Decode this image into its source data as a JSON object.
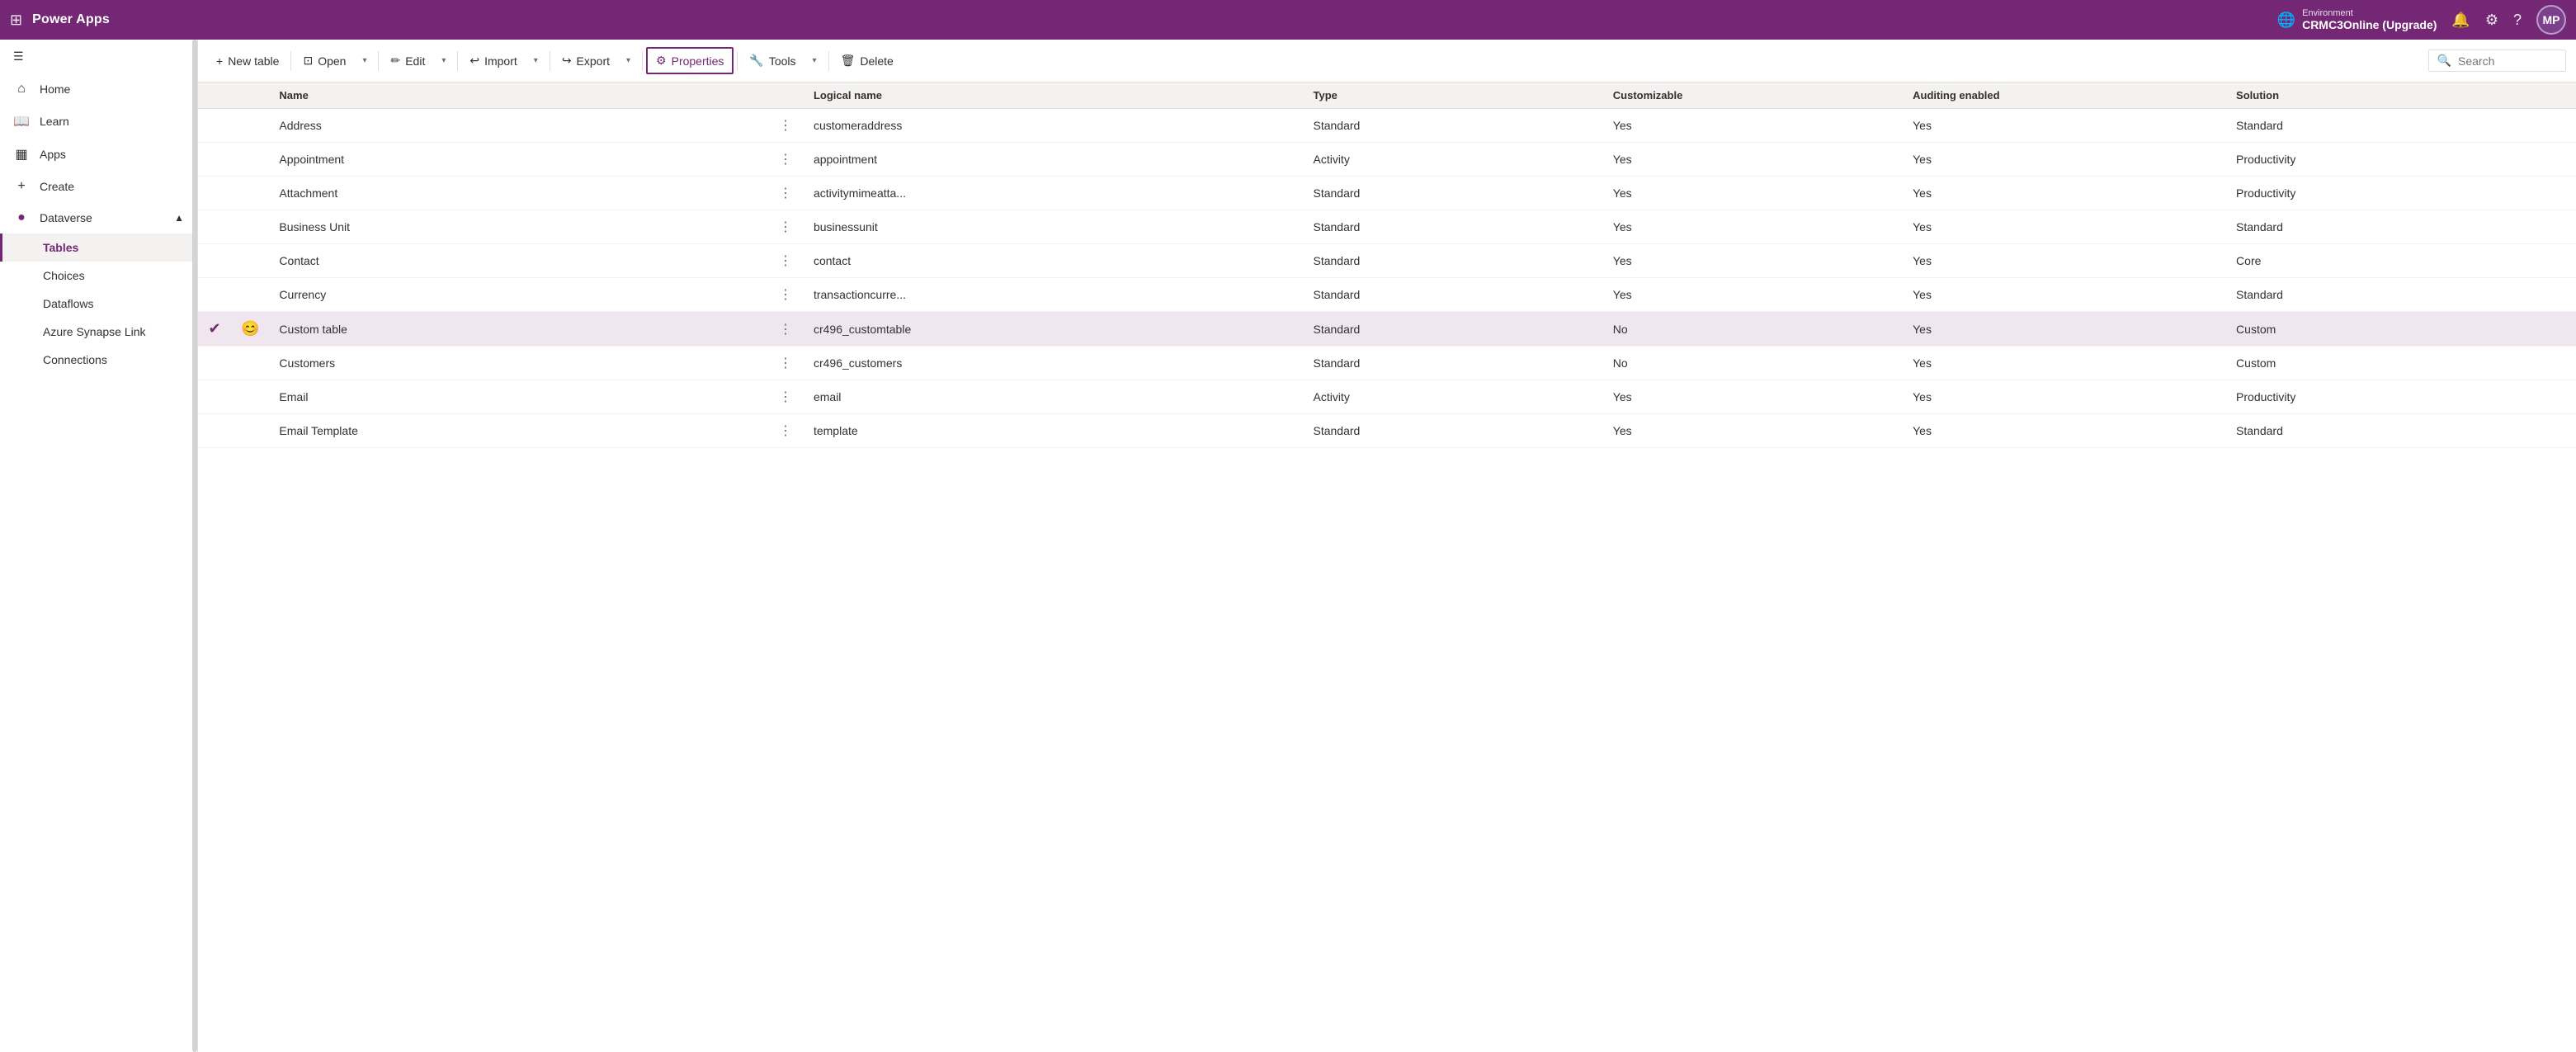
{
  "topbar": {
    "grid_icon": "⊞",
    "title": "Power Apps",
    "environment_label": "Environment",
    "environment_name": "CRMC3Online (Upgrade)",
    "avatar_text": "MP"
  },
  "toolbar": {
    "new_table": "New table",
    "open": "Open",
    "edit": "Edit",
    "import": "Import",
    "export": "Export",
    "properties": "Properties",
    "tools": "Tools",
    "delete": "Delete",
    "search_placeholder": "Search"
  },
  "sidebar": {
    "menu_icon": "☰",
    "items": [
      {
        "id": "home",
        "label": "Home",
        "icon": "⌂"
      },
      {
        "id": "learn",
        "label": "Learn",
        "icon": "📖"
      },
      {
        "id": "apps",
        "label": "Apps",
        "icon": "▦"
      },
      {
        "id": "create",
        "label": "Create",
        "icon": "+"
      },
      {
        "id": "dataverse",
        "label": "Dataverse",
        "icon": "🔵",
        "expanded": true
      }
    ],
    "dataverse_children": [
      {
        "id": "tables",
        "label": "Tables",
        "active": true
      },
      {
        "id": "choices",
        "label": "Choices"
      },
      {
        "id": "dataflows",
        "label": "Dataflows"
      },
      {
        "id": "azure-synapse",
        "label": "Azure Synapse Link"
      },
      {
        "id": "connections",
        "label": "Connections"
      }
    ]
  },
  "table": {
    "columns": [
      "Name",
      "",
      "Logical name",
      "Type",
      "Customizable",
      "Auditing enabled",
      "Solution"
    ],
    "rows": [
      {
        "id": "address",
        "check": false,
        "emoji": "",
        "name": "Address",
        "logical_name": "customeraddress",
        "type": "Standard",
        "customizable": "Yes",
        "auditing": "Yes",
        "solution": "Standard",
        "selected": false
      },
      {
        "id": "appointment",
        "check": false,
        "emoji": "",
        "name": "Appointment",
        "logical_name": "appointment",
        "type": "Activity",
        "customizable": "Yes",
        "auditing": "Yes",
        "solution": "Productivity",
        "selected": false
      },
      {
        "id": "attachment",
        "check": false,
        "emoji": "",
        "name": "Attachment",
        "logical_name": "activitymimeatta...",
        "type": "Standard",
        "customizable": "Yes",
        "auditing": "Yes",
        "solution": "Productivity",
        "selected": false
      },
      {
        "id": "business-unit",
        "check": false,
        "emoji": "",
        "name": "Business Unit",
        "logical_name": "businessunit",
        "type": "Standard",
        "customizable": "Yes",
        "auditing": "Yes",
        "solution": "Standard",
        "selected": false
      },
      {
        "id": "contact",
        "check": false,
        "emoji": "",
        "name": "Contact",
        "logical_name": "contact",
        "type": "Standard",
        "customizable": "Yes",
        "auditing": "Yes",
        "solution": "Core",
        "selected": false
      },
      {
        "id": "currency",
        "check": false,
        "emoji": "",
        "name": "Currency",
        "logical_name": "transactioncurre...",
        "type": "Standard",
        "customizable": "Yes",
        "auditing": "Yes",
        "solution": "Standard",
        "selected": false
      },
      {
        "id": "custom-table",
        "check": true,
        "emoji": "😊",
        "name": "Custom table",
        "logical_name": "cr496_customtable",
        "type": "Standard",
        "customizable": "No",
        "auditing": "Yes",
        "solution": "Custom",
        "selected": true
      },
      {
        "id": "customers",
        "check": false,
        "emoji": "",
        "name": "Customers",
        "logical_name": "cr496_customers",
        "type": "Standard",
        "customizable": "No",
        "auditing": "Yes",
        "solution": "Custom",
        "selected": false
      },
      {
        "id": "email",
        "check": false,
        "emoji": "",
        "name": "Email",
        "logical_name": "email",
        "type": "Activity",
        "customizable": "Yes",
        "auditing": "Yes",
        "solution": "Productivity",
        "selected": false
      },
      {
        "id": "email-template",
        "check": false,
        "emoji": "",
        "name": "Email Template",
        "logical_name": "template",
        "type": "Standard",
        "customizable": "Yes",
        "auditing": "Yes",
        "solution": "Standard",
        "selected": false
      }
    ]
  }
}
